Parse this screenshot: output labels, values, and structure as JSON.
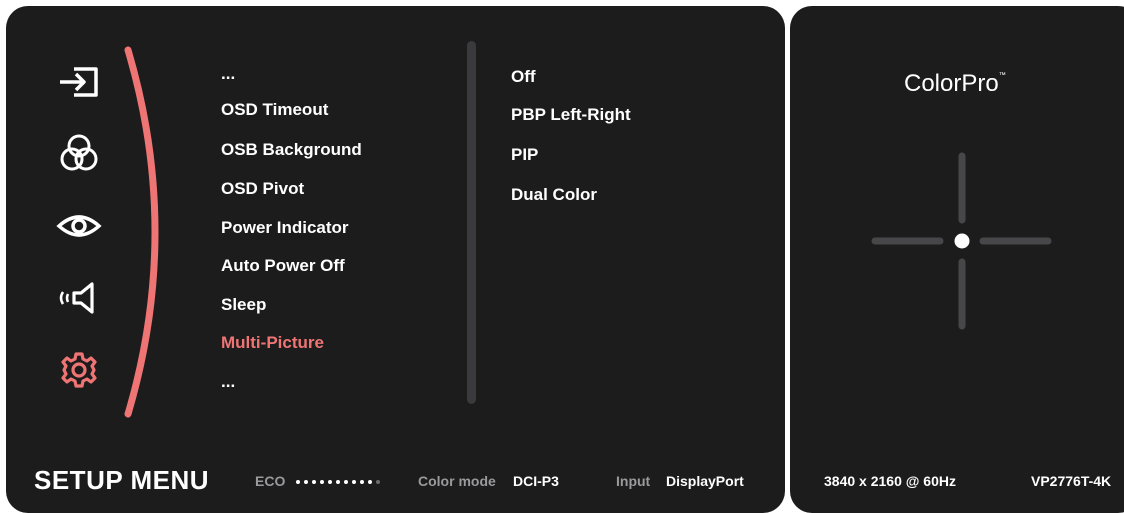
{
  "main_menu": {
    "title": "SETUP MENU",
    "category_icons": [
      "input-icon",
      "color-icon",
      "eye-icon",
      "audio-icon",
      "setup-gear-icon"
    ],
    "selected_category": "setup-gear-icon",
    "items": [
      {
        "label": "..."
      },
      {
        "label": "OSD Timeout"
      },
      {
        "label": "OSB Background"
      },
      {
        "label": "OSD Pivot"
      },
      {
        "label": "Power Indicator"
      },
      {
        "label": "Auto Power Off"
      },
      {
        "label": "Sleep"
      },
      {
        "label": "Multi-Picture",
        "selected": true
      },
      {
        "label": "..."
      }
    ],
    "options": [
      "Off",
      "PBP Left-Right",
      "PIP",
      "Dual Color"
    ]
  },
  "status_bar": {
    "eco_label": "ECO",
    "eco_level": {
      "filled": 10,
      "total": 11
    },
    "color_mode_label": "Color mode",
    "color_mode_value": "DCI-P3",
    "input_label": "Input",
    "input_value": "DisplayPort"
  },
  "side_panel": {
    "brand": "ColorPro",
    "brand_trademark": "™",
    "resolution": "3840 x 2160 @ 60Hz",
    "model": "VP2776T-4K"
  },
  "colors": {
    "panel_bg": "#1c1c1d",
    "accent": "#ef7575",
    "text": "#ffffff",
    "muted": "#9a9a9c"
  }
}
